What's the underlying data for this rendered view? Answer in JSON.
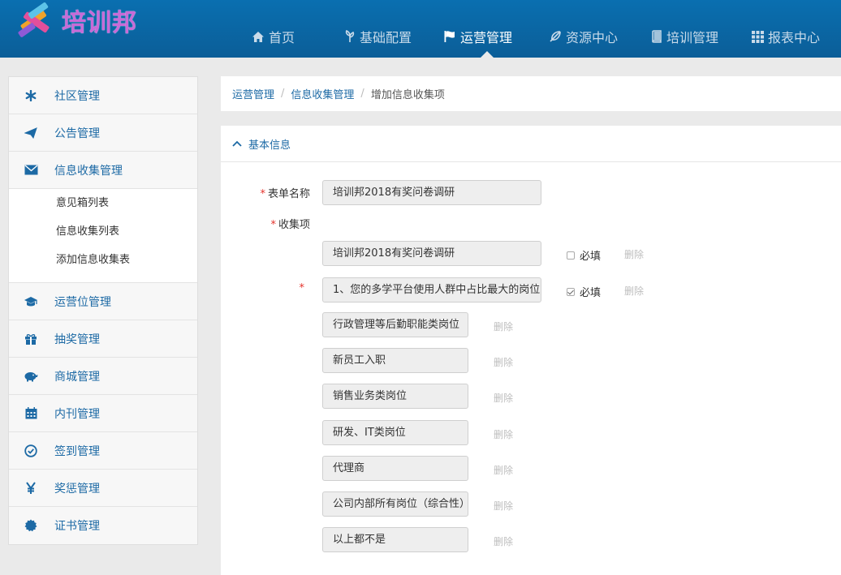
{
  "brand": {
    "name": "培训邦"
  },
  "nav": [
    {
      "label": "首页",
      "icon": "home-icon",
      "active": false
    },
    {
      "label": "基础配置",
      "icon": "leaf-icon",
      "active": false
    },
    {
      "label": "运营管理",
      "icon": "flag-icon",
      "active": true
    },
    {
      "label": "资源中心",
      "icon": "feather-icon",
      "active": false
    },
    {
      "label": "培训管理",
      "icon": "book-icon",
      "active": false
    },
    {
      "label": "报表中心",
      "icon": "grid-icon",
      "active": false
    }
  ],
  "sidebar": {
    "items": [
      {
        "label": "社区管理",
        "icon": "asterisk-icon"
      },
      {
        "label": "公告管理",
        "icon": "paper-plane-icon"
      },
      {
        "label": "信息收集管理",
        "icon": "envelope-icon"
      },
      {
        "label": "运营位管理",
        "icon": "graduation-cap-icon"
      },
      {
        "label": "抽奖管理",
        "icon": "gift-icon"
      },
      {
        "label": "商城管理",
        "icon": "piggy-bank-icon"
      },
      {
        "label": "内刊管理",
        "icon": "calendar-icon"
      },
      {
        "label": "签到管理",
        "icon": "check-circle-icon"
      },
      {
        "label": "奖惩管理",
        "icon": "yen-icon"
      },
      {
        "label": "证书管理",
        "icon": "certificate-icon"
      }
    ],
    "sub_items": [
      "意见箱列表",
      "信息收集列表",
      "添加信息收集表"
    ]
  },
  "breadcrumb": {
    "level1": "运营管理",
    "level2": "信息收集管理",
    "current": "增加信息收集项",
    "separator": "/"
  },
  "panel": {
    "title": "基本信息"
  },
  "form": {
    "required_mark": "*",
    "form_name_label": "表单名称",
    "form_name_value": "培训邦2018有奖问卷调研",
    "collect_label": "收集项",
    "required_label": "必填",
    "delete_label": "删除",
    "items": [
      {
        "value": "培训邦2018有奖问卷调研",
        "required": false
      },
      {
        "value": "1、您的多学平台使用人群中占比最大的岗位",
        "required": true
      }
    ],
    "options": [
      "行政管理等后勤职能类岗位",
      "新员工入职",
      "销售业务类岗位",
      "研发、IT类岗位",
      "代理商",
      "公司内部所有岗位（综合性）",
      "以上都不是"
    ]
  },
  "colors": {
    "header": "#0b66a6",
    "link": "#1d6aa5",
    "required": "#e5322b",
    "brand_text": "#c86ad8"
  }
}
